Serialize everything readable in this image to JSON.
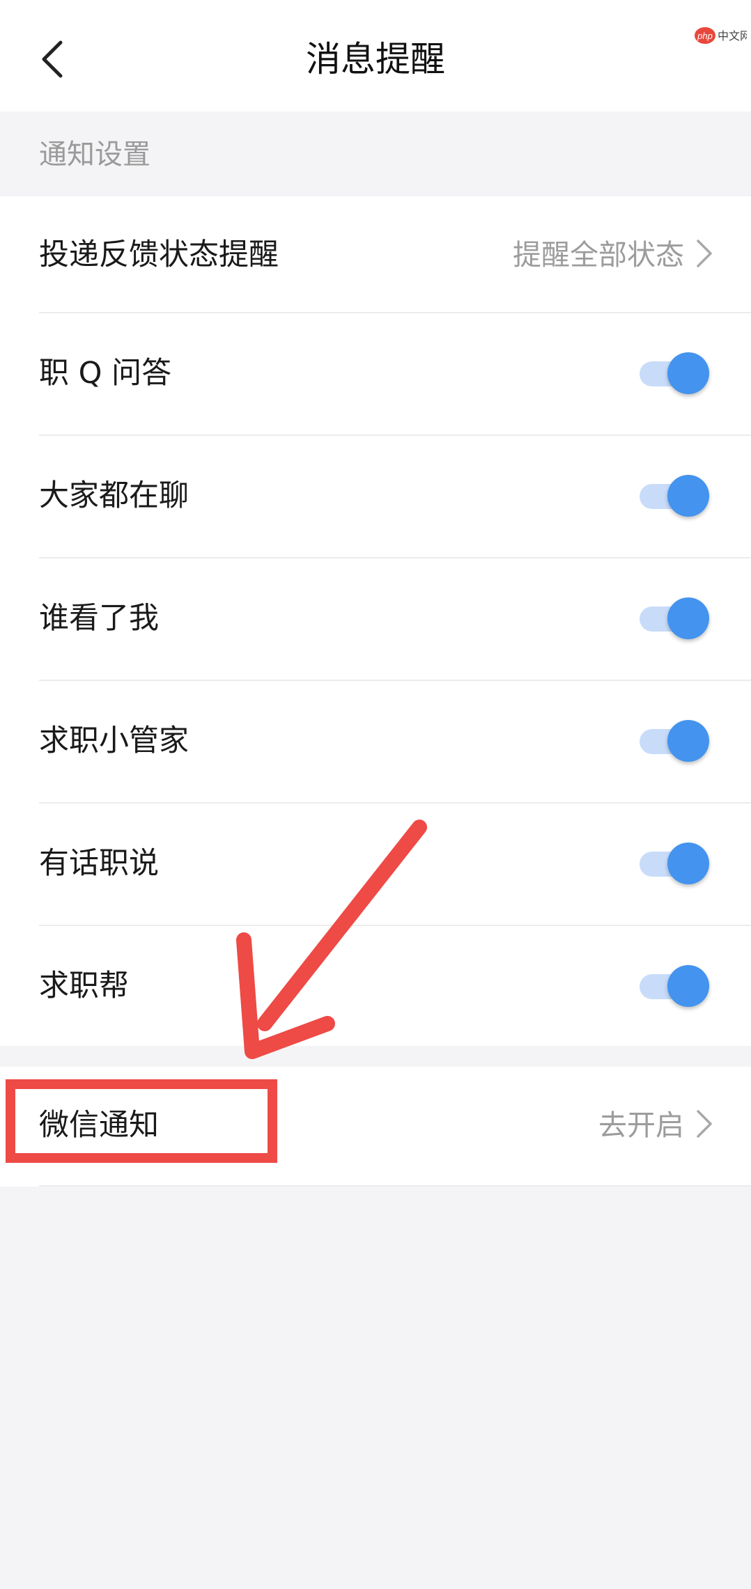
{
  "header": {
    "title": "消息提醒"
  },
  "section": {
    "title": "通知设置"
  },
  "delivery": {
    "label": "投递反馈状态提醒",
    "value": "提醒全部状态"
  },
  "toggles": [
    {
      "label": "职 Q 问答",
      "on": true
    },
    {
      "label": "大家都在聊",
      "on": true
    },
    {
      "label": "谁看了我",
      "on": true
    },
    {
      "label": "求职小管家",
      "on": true
    },
    {
      "label": "有话职说",
      "on": true
    },
    {
      "label": "求职帮",
      "on": true
    }
  ],
  "wechat": {
    "label": "微信通知",
    "value": "去开启"
  },
  "colors": {
    "accent": "#4393ef",
    "toggle_track": "#c8dcfa",
    "annotation": "#ee4a46",
    "background": "#f4f4f6"
  },
  "icons": {
    "back": "chevron-left-icon",
    "forward": "chevron-right-icon"
  },
  "watermark": "php中文网"
}
